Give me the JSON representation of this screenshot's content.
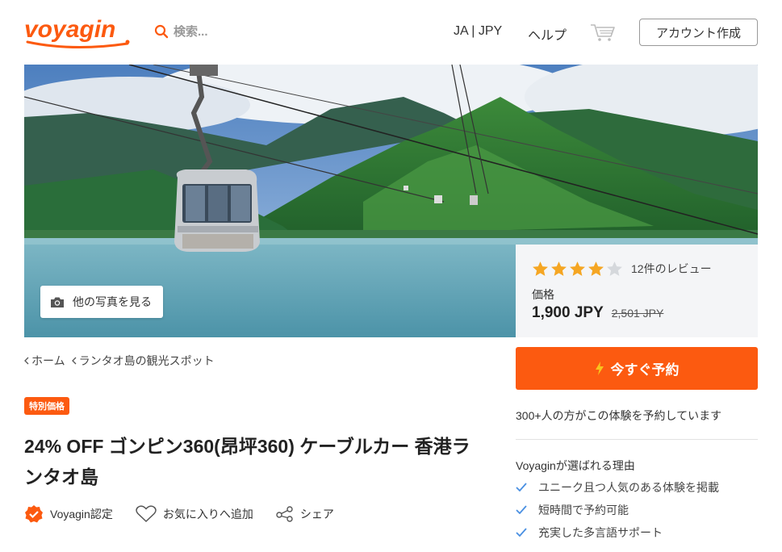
{
  "header": {
    "logo_text": "voyagin",
    "search_placeholder": "検索...",
    "lang_currency": "JA | JPY",
    "help": "ヘルプ",
    "account_button": "アカウント作成"
  },
  "hero": {
    "photos_button": "他の写真を見る"
  },
  "price_card": {
    "rating": 4,
    "rating_max": 5,
    "review_count": "12件のレビュー",
    "price_label": "価格",
    "price": "1,900 JPY",
    "old_price": "2,501 JPY"
  },
  "booking": {
    "book_button": "今すぐ予約",
    "booked_count": "300+人の方がこの体験を予約しています",
    "reasons_title": "Voyaginが選ばれる理由",
    "reasons": [
      "ユニーク且つ人気のある体験を掲載",
      "短時間で予約可能",
      "充実した多言語サポート"
    ]
  },
  "breadcrumb": [
    "ホーム",
    "ランタオ島の観光スポット"
  ],
  "badge": "特別価格",
  "title": "24% OFF ゴンピン360(昂坪360) ケーブルカー 香港ランタオ島",
  "meta": {
    "certified": "Voyagin認定",
    "favorite": "お気に入りへ追加",
    "share": "シェア"
  },
  "colors": {
    "brand": "#fc5a10",
    "star": "#f5a623"
  }
}
